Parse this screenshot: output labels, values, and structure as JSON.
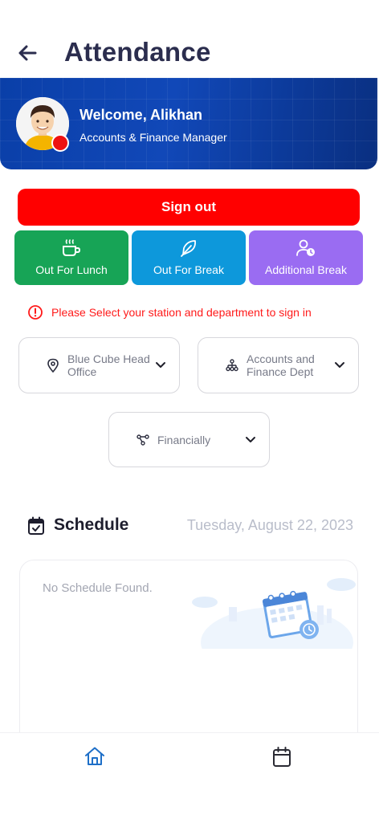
{
  "header": {
    "title": "Attendance"
  },
  "banner": {
    "welcome": "Welcome, Alikhan",
    "role": "Accounts & Finance Manager"
  },
  "actions": {
    "sign_out": "Sign out",
    "out_for_lunch": "Out For Lunch",
    "out_for_break": "Out For Break",
    "additional_break": "Additional Break"
  },
  "warning": "Please Select your station and department to sign in",
  "selects": {
    "station": {
      "line1": "Blue Cube Head",
      "line2": "Office"
    },
    "department": {
      "line1": "Accounts and",
      "line2": "Finance Dept"
    },
    "category": {
      "value": "Financially"
    }
  },
  "schedule": {
    "title": "Schedule",
    "date": "Tuesday, August 22, 2023",
    "empty_message": "No Schedule Found."
  },
  "colors": {
    "sign_out": "#ff0000",
    "lunch": "#17a456",
    "break": "#0d98db",
    "additional": "#9a6cf2",
    "banner": "#0a3fa8"
  },
  "icons": {
    "back": "arrow-left-icon",
    "lunch": "coffee-cup-icon",
    "break": "feather-icon",
    "additional": "user-clock-icon",
    "warning": "info-circle-icon",
    "station": "location-pin-icon",
    "department": "hierarchy-icon",
    "category": "branch-icon",
    "schedule": "calendar-check-icon",
    "nav_home": "home-icon",
    "nav_calendar": "calendar-icon"
  }
}
